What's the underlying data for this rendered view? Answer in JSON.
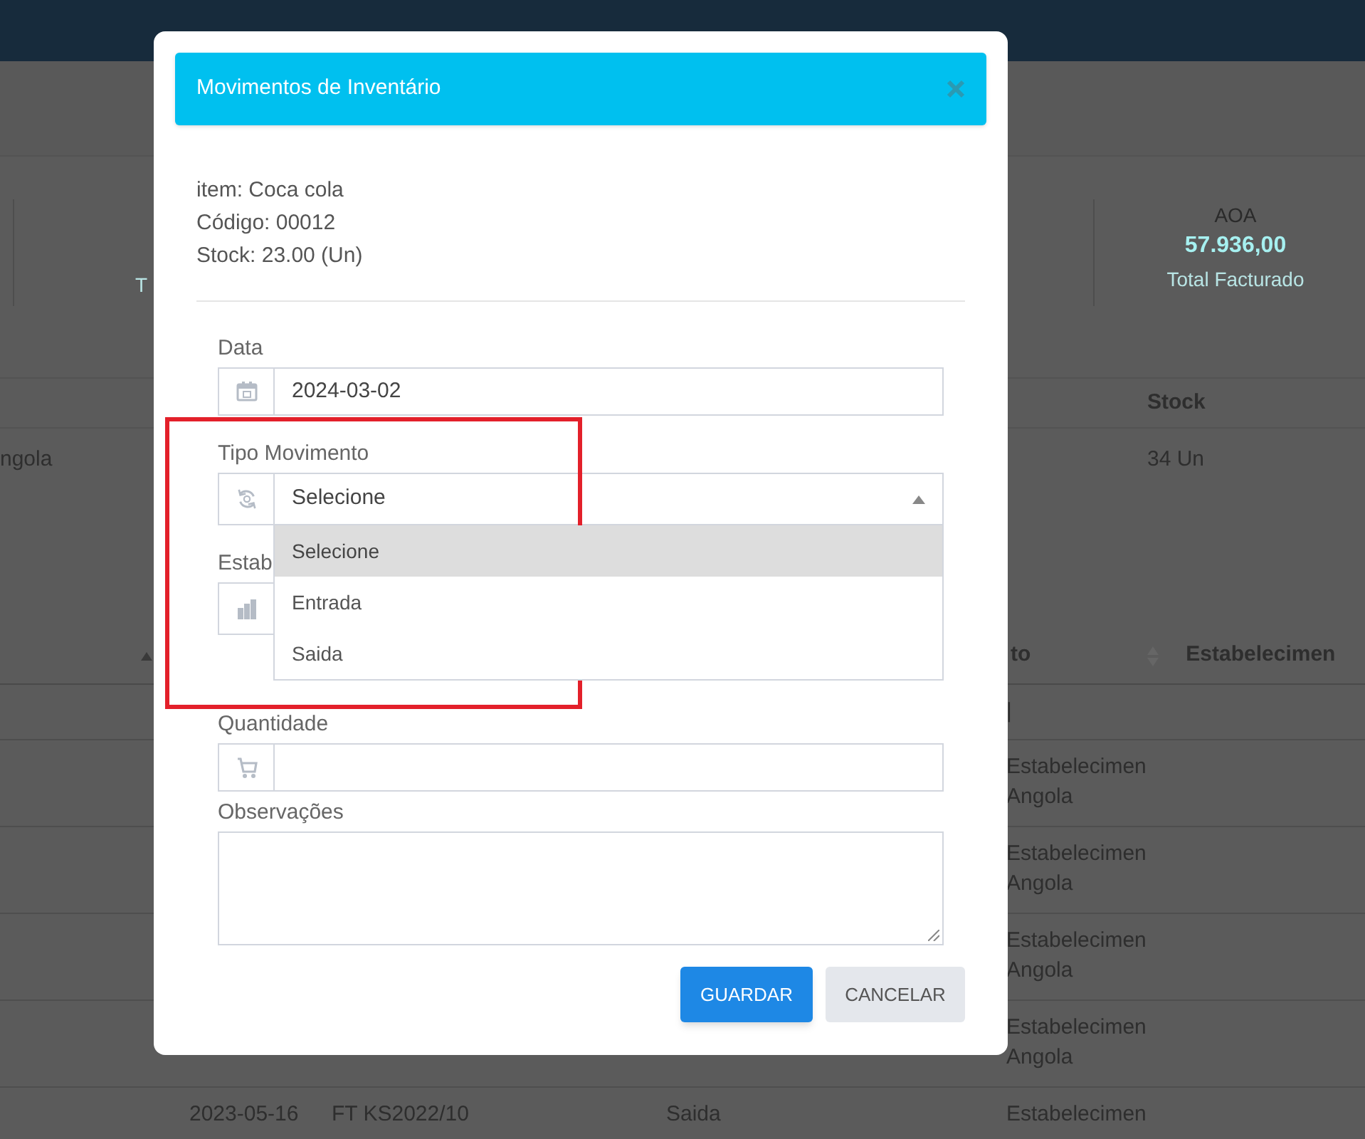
{
  "background": {
    "summary": {
      "partial_label": "T",
      "currency": "AOA",
      "total": "57.936,00",
      "total_label": "Total Facturado"
    },
    "table_1": {
      "columns": [
        "Stock"
      ],
      "rows": [
        {
          "column_1": "ngola",
          "column_2": "34 Un"
        }
      ]
    },
    "table_2": {
      "columns": [
        "to",
        "Estabelecimen"
      ],
      "rows": [
        {
          "establishment": [
            "|"
          ]
        },
        {
          "establishment": [
            "Estabelecimen",
            "Angola"
          ]
        },
        {
          "establishment": [
            "Estabelecimen",
            "Angola"
          ]
        },
        {
          "establishment": [
            "Estabelecimen",
            "Angola"
          ]
        },
        {
          "establishment": [
            "Estabelecimen",
            "Angola"
          ]
        },
        {
          "date": "2023-05-16",
          "document": "FT KS2022/10",
          "type": "Saida",
          "establishment": [
            "Estabelecimen"
          ]
        }
      ]
    }
  },
  "modal": {
    "title": "Movimentos de Inventário",
    "info": [
      "item: Coca cola",
      "Código: 00012",
      "Stock: 23.00 (Un)"
    ],
    "fields": [
      {
        "kind": "date",
        "label": "Data",
        "value": "2024-03-02"
      },
      {
        "kind": "select",
        "label": "Tipo Movimento",
        "value": "Selecione",
        "expanded": true,
        "options": [
          {
            "label": "Selecione",
            "selected": true
          },
          {
            "label": "Entrada",
            "selected": false
          },
          {
            "label": "Saida",
            "selected": false
          }
        ]
      },
      {
        "kind": "establishment",
        "label": "Estab"
      },
      {
        "kind": "quantity",
        "label": "Quantidade"
      },
      {
        "kind": "textarea",
        "label": "Observações"
      }
    ],
    "buttons": [
      {
        "label": "GUARDAR",
        "kind": "primary"
      },
      {
        "label": "CANCELAR",
        "kind": "secondary"
      }
    ]
  }
}
